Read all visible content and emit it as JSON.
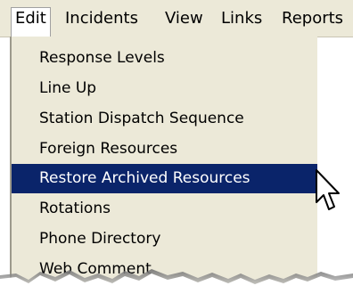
{
  "menubar": {
    "items": [
      {
        "label": "Edit",
        "active": true
      },
      {
        "label": "Incidents"
      },
      {
        "label": "View"
      },
      {
        "label": "Links"
      },
      {
        "label": "Reports"
      }
    ]
  },
  "dropdown": {
    "items": [
      {
        "label": "Response Levels"
      },
      {
        "label": "Line Up"
      },
      {
        "label": "Station Dispatch Sequence"
      },
      {
        "label": "Foreign Resources"
      },
      {
        "label": "Restore Archived Resources",
        "highlighted": true
      },
      {
        "label": "Rotations"
      },
      {
        "label": "Phone Directory"
      },
      {
        "label": "Web Comment"
      }
    ]
  },
  "colors": {
    "menu_bg": "#ece9d8",
    "highlight_bg": "#0a246a",
    "highlight_fg": "#ffffff"
  }
}
